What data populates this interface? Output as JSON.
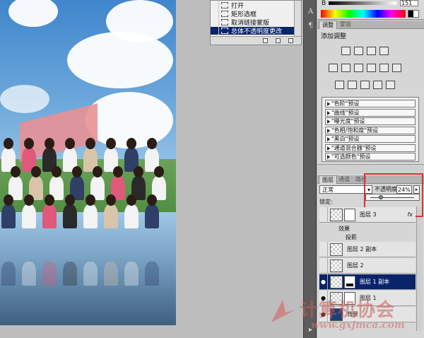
{
  "history": {
    "items": [
      {
        "label": "打开",
        "selected": false
      },
      {
        "label": "矩形选框",
        "selected": false
      },
      {
        "label": "取消链接蒙版",
        "selected": false
      },
      {
        "label": "总体不透明度更改",
        "selected": true
      }
    ]
  },
  "color_panel": {
    "channel_label": "B",
    "value": "151"
  },
  "toolstrip": {
    "icons": [
      "A",
      "¶"
    ]
  },
  "adjustments": {
    "tabs": [
      "调整",
      "蒙版"
    ],
    "title": "添加调整",
    "presets": [
      "\"色阶\"预设",
      "\"曲线\"预设",
      "\"曝光度\"预设",
      "\"色相/饱和度\"预设",
      "\"黑白\"预设",
      "\"通道混合器\"预设",
      "\"可选颜色\"预设"
    ]
  },
  "layers_panel": {
    "tabs": [
      "图层",
      "通道",
      "路径"
    ],
    "blend_mode": "正常",
    "opacity_label": "不透明度:",
    "opacity_value": "24%",
    "opacity_level": 0.24,
    "lock_label": "锁定:",
    "layers": [
      {
        "name": "图层 3",
        "fx": "fx",
        "visible": false,
        "selected": false,
        "thumb": "checker",
        "mask": "white"
      },
      {
        "name": "图层 2 副本",
        "fx": "",
        "visible": false,
        "selected": false,
        "thumb": "checker",
        "mask": ""
      },
      {
        "name": "图层 2",
        "fx": "",
        "visible": false,
        "selected": false,
        "thumb": "checker",
        "mask": ""
      },
      {
        "name": "图层 1 副本",
        "fx": "",
        "visible": true,
        "selected": true,
        "thumb": "checker",
        "mask": "black"
      },
      {
        "name": "图层 1",
        "fx": "",
        "visible": true,
        "selected": false,
        "thumb": "checker",
        "mask": "white"
      },
      {
        "name": "背景",
        "fx": "",
        "visible": true,
        "selected": false,
        "thumb": "dark",
        "mask": ""
      }
    ],
    "effects_label": "效果",
    "effect_item": "投影"
  },
  "watermark": {
    "text": "计算机协会",
    "url": "www.gxjmca.com"
  }
}
